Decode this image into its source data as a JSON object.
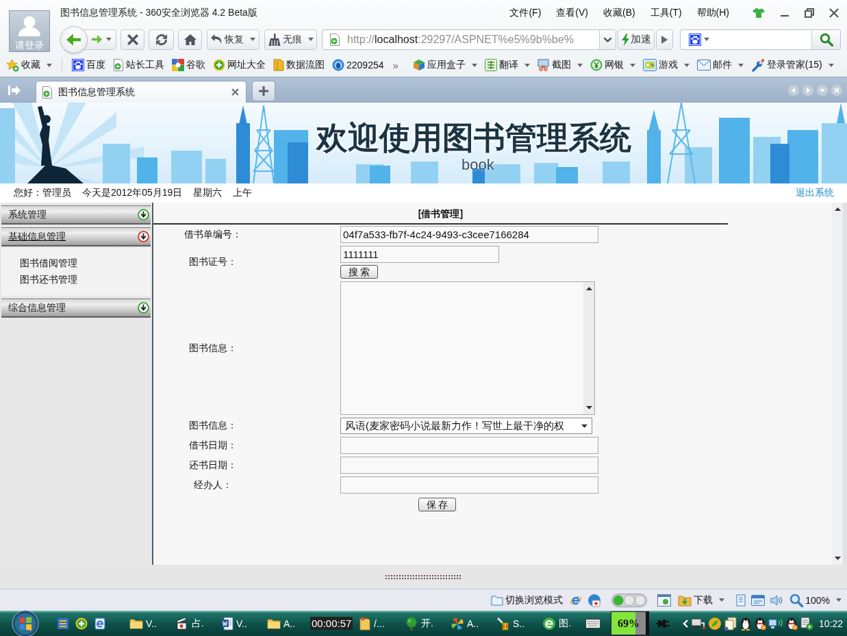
{
  "browser": {
    "title": "图书信息管理系统 - 360安全浏览器 4.2 Beta版",
    "login": "请登录",
    "menu": [
      "文件(F)",
      "查看(V)",
      "收藏(B)",
      "工具(T)",
      "帮助(H)"
    ]
  },
  "toolbar": {
    "buttons": [
      {
        "label": "恢复"
      },
      {
        "label": "无痕"
      }
    ],
    "address": {
      "scheme": "http://",
      "host": "localhost",
      "path": ":29297/ASPNET%e5%9b%be%"
    },
    "accelerate": "加速"
  },
  "favorites": [
    {
      "label": "收藏",
      "dropdown": true
    },
    {
      "label": "百度",
      "dropdown": false
    },
    {
      "label": "站长工具",
      "dropdown": false
    },
    {
      "label": "谷歌",
      "dropdown": false
    },
    {
      "label": "网址大全",
      "dropdown": false
    },
    {
      "label": "数据流图",
      "dropdown": false
    },
    {
      "label": "2209254",
      "dropdown": false
    }
  ],
  "chevron": "»",
  "apps": [
    {
      "label": "应用盒子",
      "dropdown": true
    },
    {
      "label": "翻译",
      "dropdown": true
    },
    {
      "label": "截图",
      "dropdown": true
    },
    {
      "label": "网银",
      "dropdown": true
    },
    {
      "label": "游戏",
      "dropdown": true
    },
    {
      "label": "邮件",
      "dropdown": true
    },
    {
      "label": "登录管家(15)",
      "dropdown": true
    }
  ],
  "tabs": [
    {
      "label": "图书信息管理系统",
      "selected": true
    }
  ],
  "header": {
    "title": "欢迎使用图书管理系统",
    "subtitle": "book"
  },
  "greeting": {
    "user": "您好：管理员",
    "date": "今天是2012年05月19日",
    "weekday": "星期六",
    "period": "上午",
    "logout": "退出系统"
  },
  "sidebar": [
    {
      "label": "系统管理",
      "expanded": false
    },
    {
      "label": "基础信息管理",
      "expanded": true,
      "children": [
        {
          "label": "图书借阅管理"
        },
        {
          "label": "图书还书管理"
        }
      ]
    },
    {
      "label": "综合信息管理",
      "expanded": false
    }
  ],
  "form": {
    "title": "[借书管理]",
    "rows": [
      {
        "kind": "input",
        "label": "借书单编号：",
        "value": "04f7a533-fb7f-4c24-9493-c3cee7166284"
      },
      {
        "kind": "search",
        "label": "图书证号：",
        "value": "1111111",
        "button": "搜索"
      },
      {
        "kind": "textarea",
        "label": "图书信息："
      },
      {
        "kind": "select",
        "label": "图书信息：",
        "value": "风语(麦家密码小说最新力作！写世上最干净的权"
      },
      {
        "kind": "input",
        "label": "借书日期："
      },
      {
        "kind": "input",
        "label": "还书日期："
      },
      {
        "kind": "input",
        "label": "经办人："
      }
    ],
    "save": "保存"
  },
  "status_bar": {
    "mode": "切换浏览模式",
    "download": "下载",
    "zoom": "100%"
  },
  "taskbar": {
    "tasks": [
      {
        "kind": "task",
        "label": "V.."
      },
      {
        "kind": "task",
        "label": "占."
      },
      {
        "kind": "task",
        "label": "V.."
      },
      {
        "kind": "task",
        "label": "A.."
      },
      {
        "kind": "timer",
        "label": "00:00:57"
      },
      {
        "kind": "task",
        "label": "/..."
      },
      {
        "kind": "task",
        "label": "开."
      },
      {
        "kind": "task",
        "label": "A.."
      },
      {
        "kind": "task",
        "label": "S.."
      },
      {
        "kind": "task",
        "label": "图."
      }
    ],
    "battery": {
      "level": 0.69,
      "reading": "69%"
    },
    "clock": "10:22"
  }
}
